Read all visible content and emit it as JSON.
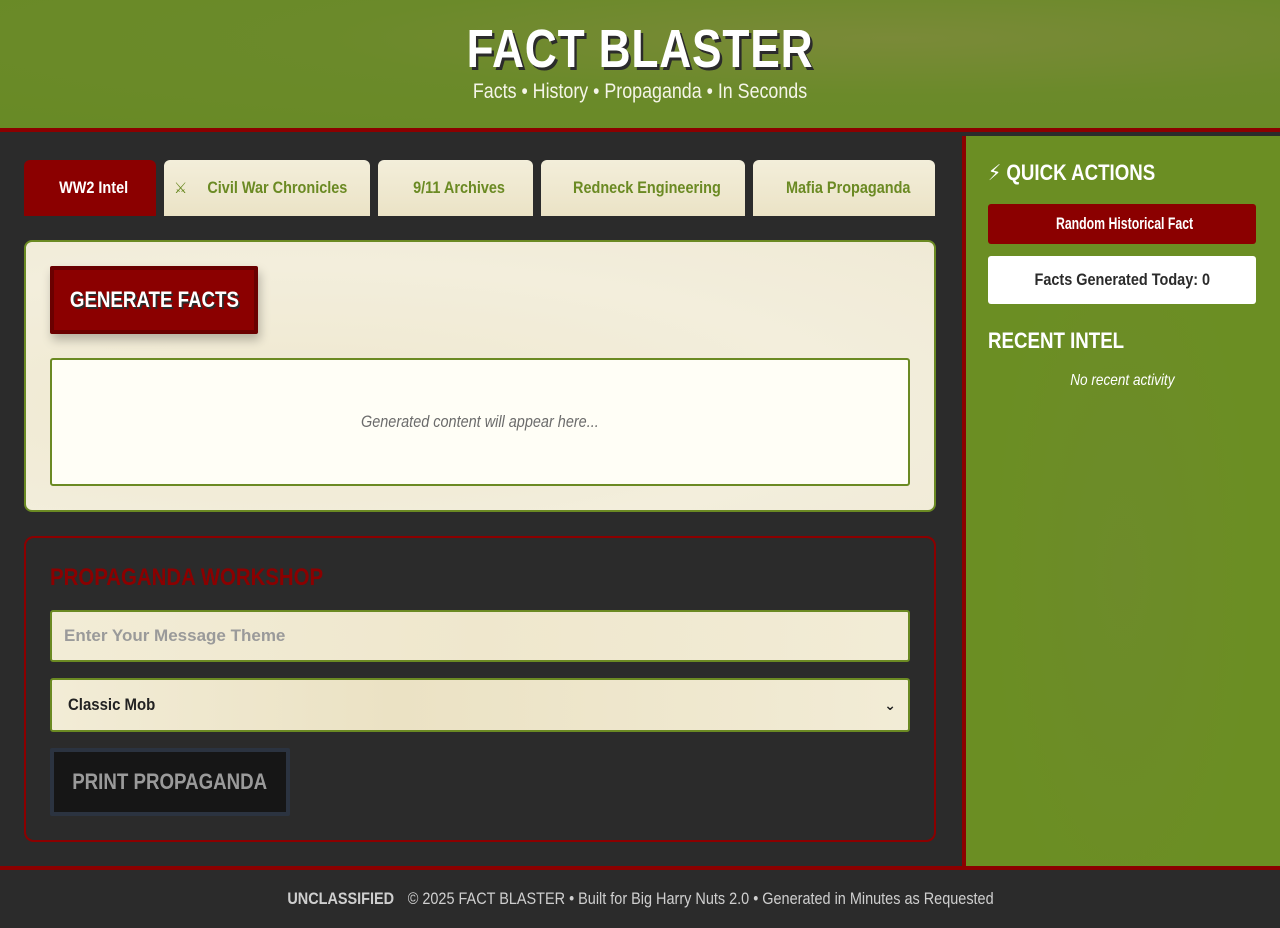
{
  "header": {
    "title": "FACT BLASTER",
    "subtitle": "Facts • History • Propaganda • In Seconds"
  },
  "tabs": [
    {
      "label": "WW2 Intel",
      "icon": "tank-icon",
      "glyph": "",
      "active": true
    },
    {
      "label": "Civil War Chronicles",
      "icon": "crossed-swords-icon",
      "glyph": "⚔",
      "active": false
    },
    {
      "label": "9/11 Archives",
      "icon": "building-icon",
      "glyph": "",
      "active": false
    },
    {
      "label": "Redneck Engineering",
      "icon": "wrench-icon",
      "glyph": "",
      "active": false
    },
    {
      "label": "Mafia Propaganda",
      "icon": "fedora-icon",
      "glyph": "",
      "active": false
    }
  ],
  "generator": {
    "button_label": "GENERATE FACTS",
    "output_placeholder": "Generated content will appear here..."
  },
  "workshop": {
    "title_glyph": "",
    "title": "PROPAGANDA WORKSHOP",
    "theme_placeholder": "Enter Your Message Theme",
    "style_selected": "Classic Mob",
    "print_label": "PRINT PROPAGANDA"
  },
  "sidebar": {
    "quick_actions_glyph": "⚡",
    "quick_actions_title": "QUICK ACTIONS",
    "random_glyph": "",
    "random_label": "Random Historical Fact",
    "counter_label": "Facts Generated Today: 0",
    "recent_glyph": "",
    "recent_title": "RECENT INTEL",
    "recent_empty": "No recent activity"
  },
  "footer": {
    "classification_glyph": "",
    "classification": "UNCLASSIFIED",
    "text": "© 2025 FACT BLASTER • Built for Big Harry Nuts 2.0 • Generated in Minutes as Requested"
  },
  "colors": {
    "olive": "#6b8e23",
    "crimson": "#8b0000",
    "charcoal": "#2b2b2b",
    "parchment": "#f0ead6"
  }
}
